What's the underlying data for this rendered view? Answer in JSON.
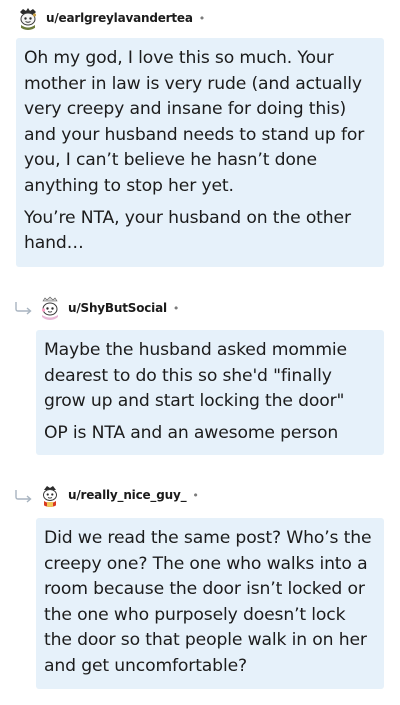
{
  "comments": [
    {
      "username": "u/earlgreylavandertea",
      "separator": "•",
      "avatar_icon": "snoo-avatar-icon",
      "paragraphs": [
        "Oh my god, I love this so much. Your mother in law is very rude (and actually very creepy and insane for doing this) and your husband needs to stand up for you, I can’t believe he hasn’t done anything to stop her yet.",
        "You’re NTA, your husband on the other hand…"
      ]
    },
    {
      "username": "u/ShyButSocial",
      "separator": "•",
      "avatar_icon": "snoo-avatar-icon",
      "reply_icon": "reply-arrow-icon",
      "paragraphs": [
        "Maybe the husband asked mommie dearest to do this so she'd \"finally grow up and start locking the door\"",
        "OP is NTA and an awesome person"
      ]
    },
    {
      "username": "u/really_nice_guy_",
      "separator": "•",
      "avatar_icon": "snoo-avatar-icon",
      "reply_icon": "reply-arrow-icon",
      "paragraphs": [
        "Did we read the same post? Who’s the creepy one? The one who walks into a room because the door isn’t locked or the one who purposely doesn’t lock the door so that people walk in on her and get uncomfortable?"
      ]
    }
  ],
  "colors": {
    "bubble_background": "#e6f1fa",
    "text": "#1c1c1c",
    "meta": "#7c7c7c",
    "reply_arrow": "#a8b4c0"
  }
}
